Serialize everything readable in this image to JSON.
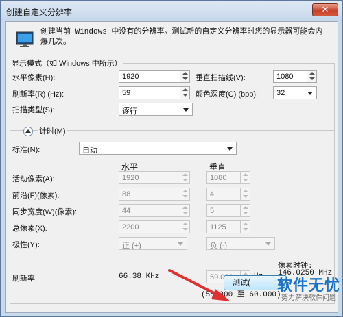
{
  "window": {
    "title": "创建自定义分辨率",
    "close_glyph": "✕"
  },
  "description": "创建当前 Windows 中没有的分辨率。测试新的自定义分辨率时您的显示器可能会内爆几次。",
  "display_mode": {
    "legend": "显示模式（如 Windows 中所示）",
    "h_pixels_label": "水平像素(H):",
    "h_pixels_value": "1920",
    "v_scanlines_label": "垂直扫描线(V):",
    "v_scanlines_value": "1080",
    "refresh_label": "刷新率(R) (Hz):",
    "refresh_value": "59",
    "color_depth_label": "颜色深度(C) (bpp):",
    "color_depth_value": "32",
    "scan_type_label": "扫描类型(S):",
    "scan_type_value": "逐行"
  },
  "timing": {
    "legend": "计时(M)",
    "standard_label": "标准(N):",
    "standard_value": "自动",
    "col_horizontal": "水平",
    "col_vertical": "垂直",
    "rows": [
      {
        "label": "活动像素(A):",
        "h": "1920",
        "v": "1080"
      },
      {
        "label": "前沿(F)(像素):",
        "h": "88",
        "v": "4"
      },
      {
        "label": "同步宽度(W)(像素):",
        "h": "44",
        "v": "5"
      },
      {
        "label": "总像素(X):",
        "h": "2200",
        "v": "1125"
      }
    ],
    "polarity_label": "极性(Y):",
    "polarity_h": "正 (+)",
    "polarity_v": "负 (-)",
    "refresh_label": "刷新率:",
    "refresh_h": "66.38 KHz",
    "refresh_v": "59.000",
    "refresh_v_unit": "Hz",
    "refresh_range": "(58.000 至 60.000)",
    "pixel_clock_label": "像素时钟:",
    "pixel_clock_value": "146.0250 MHz"
  },
  "test_button_label": "测试(",
  "watermark": {
    "main": "软件无忧",
    "sub": "努力解决软件问题"
  },
  "colors": {
    "accent": "#1b73c8",
    "arrow": "#e03030"
  }
}
